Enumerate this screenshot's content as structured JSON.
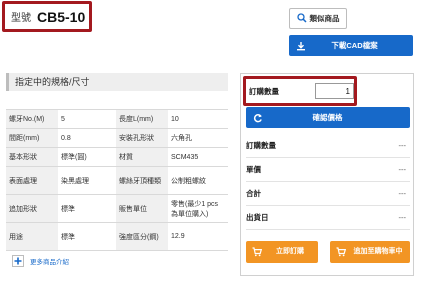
{
  "model": {
    "label": "型號",
    "value": "CB5-10"
  },
  "toolbar": {
    "similar_label": "類似商品",
    "cad_label": "下載CAD檔案"
  },
  "specs": {
    "title": "指定中的規格/尺寸",
    "rows": [
      {
        "k1": "螺牙No.(M)",
        "v1": "5",
        "k2": "長度L(mm)",
        "v2": "10"
      },
      {
        "k1": "間距(mm)",
        "v1": "0.8",
        "k2": "安裝孔形狀",
        "v2": "六角孔"
      },
      {
        "k1": "基本形狀",
        "v1": "標準(圓)",
        "k2": "材質",
        "v2": "SCM435"
      },
      {
        "k1": "表面處理",
        "v1": "染黑處理",
        "k2": "螺絲牙頂種類",
        "v2": "公制粗螺紋"
      },
      {
        "k1": "追加形狀",
        "v1": "標準",
        "k2": "販售單位",
        "v2": "零售(最少1 pcs為單位購入)"
      },
      {
        "k1": "用途",
        "v1": "標準",
        "k2": "強度區分(鋼)",
        "v2": "12.9"
      }
    ],
    "more_label": "更多商品介紹"
  },
  "order": {
    "qty_label": "訂購數量",
    "qty_value": "1",
    "confirm_label": "確認價格",
    "summary": [
      {
        "label": "訂購數量",
        "value": "---"
      },
      {
        "label": "單價",
        "value": "---"
      },
      {
        "label": "合計",
        "value": "---"
      },
      {
        "label": "出貨日",
        "value": "---"
      }
    ],
    "order_now_label": "立即訂購",
    "add_cart_label": "追加至購物車中"
  },
  "colors": {
    "accent_blue": "#1769c9",
    "highlight_red": "#a3191f",
    "order_orange": "#f29524"
  }
}
